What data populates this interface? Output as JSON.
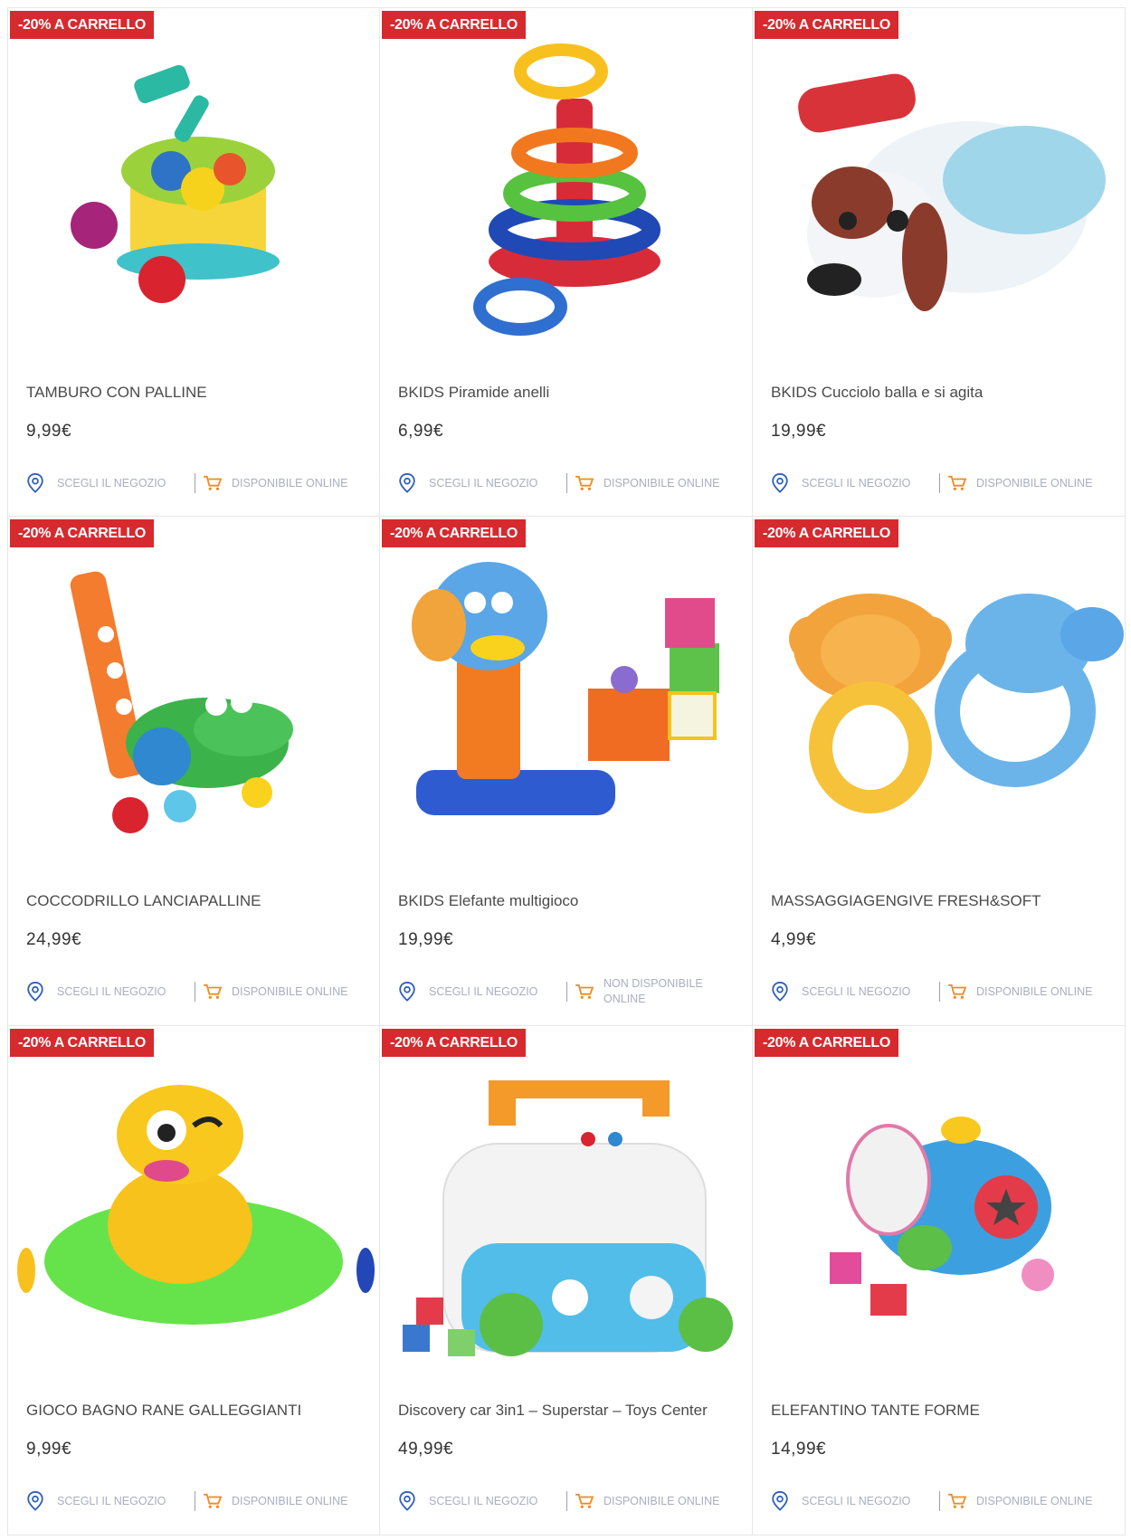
{
  "products": [
    {
      "badge": "-20% A CARRELLO",
      "title": "TAMBURO CON PALLINE",
      "price": "9,99€",
      "store_label": "SCEGLI IL NEGOZIO",
      "availability": "DISPONIBILE ONLINE",
      "image": "drum-with-balls-toy"
    },
    {
      "badge": "-20% A CARRELLO",
      "title": "BKIDS Piramide anelli",
      "price": "6,99€",
      "store_label": "SCEGLI IL NEGOZIO",
      "availability": "DISPONIBILE ONLINE",
      "image": "ring-pyramid-toy"
    },
    {
      "badge": "-20% A CARRELLO",
      "title": "BKIDS Cucciolo balla e si agita",
      "price": "19,99€",
      "store_label": "SCEGLI IL NEGOZIO",
      "availability": "DISPONIBILE ONLINE",
      "image": "dancing-puppy-toy"
    },
    {
      "badge": "-20% A CARRELLO",
      "title": "COCCODRILLO LANCIAPALLINE",
      "price": "24,99€",
      "store_label": "SCEGLI IL NEGOZIO",
      "availability": "DISPONIBILE ONLINE",
      "image": "crocodile-ball-popper-toy"
    },
    {
      "badge": "-20% A CARRELLO",
      "title": "BKIDS Elefante multigioco",
      "price": "19,99€",
      "store_label": "SCEGLI IL NEGOZIO",
      "availability": "NON DISPONIBILE ONLINE",
      "image": "elephant-activity-toy"
    },
    {
      "badge": "-20% A CARRELLO",
      "title": "MASSAGGIAGENGIVE FRESH&SOFT",
      "price": "4,99€",
      "store_label": "SCEGLI IL NEGOZIO",
      "availability": "DISPONIBILE ONLINE",
      "image": "teether-toy"
    },
    {
      "badge": "-20% A CARRELLO",
      "title": "GIOCO BAGNO RANE GALLEGGIANTI",
      "price": "9,99€",
      "store_label": "SCEGLI IL NEGOZIO",
      "availability": "DISPONIBILE ONLINE",
      "image": "floating-frog-toy"
    },
    {
      "badge": "-20% A CARRELLO",
      "title": "Discovery car 3in1 – Superstar – Toys Center",
      "price": "49,99€",
      "store_label": "SCEGLI IL NEGOZIO",
      "availability": "DISPONIBILE ONLINE",
      "image": "discovery-car-toy"
    },
    {
      "badge": "-20% A CARRELLO",
      "title": "ELEFANTINO TANTE FORME",
      "price": "14,99€",
      "store_label": "SCEGLI IL NEGOZIO",
      "availability": "DISPONIBILE ONLINE",
      "image": "shape-sorter-elephant-toy"
    }
  ],
  "colors": {
    "badge": "#d62a2f",
    "icon_blue": "#2f5fbf",
    "icon_orange": "#f08a24"
  }
}
